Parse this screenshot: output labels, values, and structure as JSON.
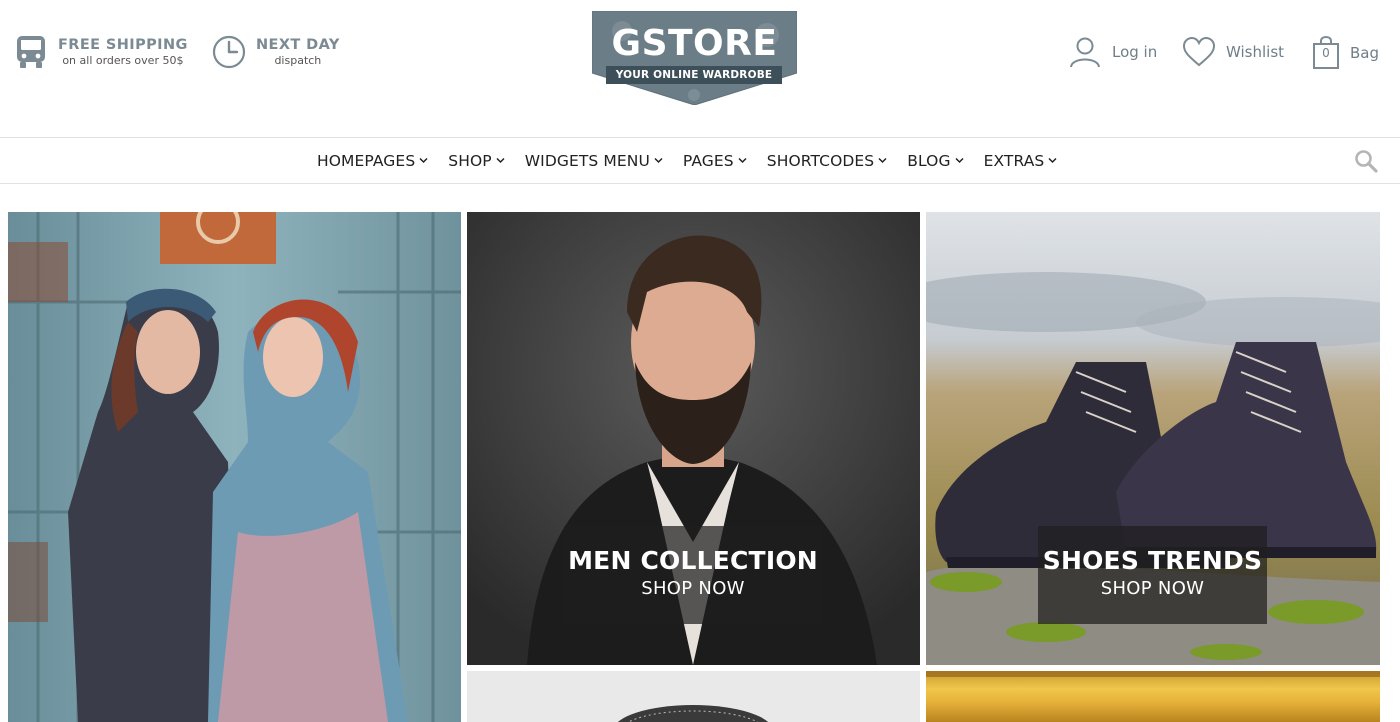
{
  "header": {
    "promos": [
      {
        "icon": "bus-icon",
        "title": "FREE SHIPPING",
        "subtitle": "on all orders over 50$"
      },
      {
        "icon": "clock-icon",
        "title": "NEXT DAY",
        "subtitle": "dispatch"
      }
    ],
    "logo": {
      "name": "GSTORE",
      "tagline": "YOUR ONLINE WARDROBE"
    },
    "account": {
      "login_label": "Log in",
      "wishlist_label": "Wishlist",
      "bag_label": "Bag",
      "bag_count": "0"
    }
  },
  "nav": {
    "items": [
      {
        "label": "HOMEPAGES"
      },
      {
        "label": "SHOP"
      },
      {
        "label": "WIDGETS MENU"
      },
      {
        "label": "PAGES"
      },
      {
        "label": "SHORTCODES"
      },
      {
        "label": "BLOG"
      },
      {
        "label": "EXTRAS"
      }
    ],
    "search_icon": "search-icon"
  },
  "tiles": {
    "men": {
      "title": "MEN COLLECTION",
      "cta": "SHOP NOW"
    },
    "shoes": {
      "title": "SHOES TRENDS",
      "cta": "SHOP NOW"
    }
  },
  "colors": {
    "logo_bg": "#6b7d86",
    "logo_tag": "#3d4f59",
    "icon_gray": "#7b8a93",
    "nav_text": "#222222",
    "caption_bg": "#1e1e1e"
  }
}
